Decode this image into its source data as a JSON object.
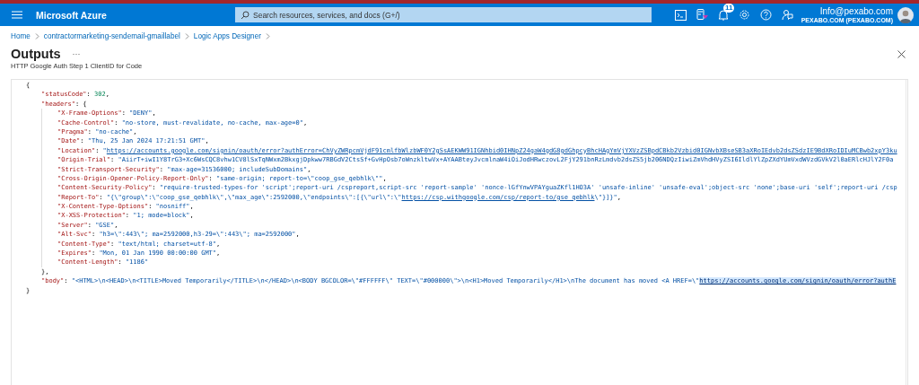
{
  "topbar": {
    "brand": "Microsoft Azure",
    "search": {
      "placeholder": "Search resources, services, and docs (G+/)"
    },
    "notification_count": "11",
    "account": {
      "email": "Info@pexabo.com",
      "directory": "PEXABO.COM (PEXABO.COM)"
    }
  },
  "breadcrumb": [
    "Home",
    "contractormarketing-sendemail-gmaillabel",
    "Logic Apps Designer"
  ],
  "panel": {
    "title": "Outputs",
    "more": "···",
    "subtitle": "HTTP Google Auth Step 1 ClientID for Code"
  },
  "code": [
    {
      "tokens": [
        {
          "kind": "punct",
          "text": "{"
        }
      ],
      "close": [
        {
          "kind": "punct",
          "text": "}"
        }
      ],
      "children": [
        {
          "tokens": [
            {
              "kind": "key",
              "text": "\"statusCode\""
            },
            {
              "kind": "punct",
              "text": ": "
            },
            {
              "kind": "num",
              "text": "302"
            },
            {
              "kind": "punct",
              "text": ","
            }
          ]
        },
        {
          "tokens": [
            {
              "kind": "key",
              "text": "\"headers\""
            },
            {
              "kind": "punct",
              "text": ": {"
            }
          ],
          "close": [
            {
              "kind": "punct",
              "text": "},"
            }
          ],
          "children": [
            {
              "tokens": [
                {
                  "kind": "key",
                  "text": "\"X-Frame-Options\""
                },
                {
                  "kind": "punct",
                  "text": ": "
                },
                {
                  "kind": "str",
                  "text": "\"DENY\""
                },
                {
                  "kind": "punct",
                  "text": ","
                }
              ]
            },
            {
              "tokens": [
                {
                  "kind": "key",
                  "text": "\"Cache-Control\""
                },
                {
                  "kind": "punct",
                  "text": ": "
                },
                {
                  "kind": "str",
                  "text": "\"no-store, must-revalidate, no-cache, max-age=0\""
                },
                {
                  "kind": "punct",
                  "text": ","
                }
              ]
            },
            {
              "tokens": [
                {
                  "kind": "key",
                  "text": "\"Pragma\""
                },
                {
                  "kind": "punct",
                  "text": ": "
                },
                {
                  "kind": "str",
                  "text": "\"no-cache\""
                },
                {
                  "kind": "punct",
                  "text": ","
                }
              ]
            },
            {
              "tokens": [
                {
                  "kind": "key",
                  "text": "\"Date\""
                },
                {
                  "kind": "punct",
                  "text": ": "
                },
                {
                  "kind": "str",
                  "text": "\"Thu, 25 Jan 2024 17:21:51 GMT\""
                },
                {
                  "kind": "punct",
                  "text": ","
                }
              ]
            },
            {
              "tokens": [
                {
                  "kind": "key",
                  "text": "\"Location\""
                },
                {
                  "kind": "punct",
                  "text": ": "
                },
                {
                  "kind": "str",
                  "text": "\""
                },
                {
                  "kind": "link",
                  "text": "https://accounts.google.com/signin/oauth/error?authError=ChVyZWRpcmVjdF91cmlfbWlzbWF0Y2gSsAEKWW91IGNhbid0IHNpZ24gaW4gdG8gdGhpcyBhcHAgYmVjYXVzZSBpdCBkb2Vzbid0IGNvbXBseSB3aXRoIEdvb2dsZSdzIE9BdXRoIDIuMCBwb2xpY3ku"
                }
              ]
            },
            {
              "tokens": [
                {
                  "kind": "key",
                  "text": "\"Origin-Trial\""
                },
                {
                  "kind": "punct",
                  "text": ": "
                },
                {
                  "kind": "str",
                  "text": "\"AiirT+iwI1Y8TrG3+Xc6WsCQC8vhw1CV8lSxTqNWxm2BkxgjDpkww7RBGdV2CtsSf+GvHpOsb7oWnzkltwVx+AYAABteyJvcmlnaW4iOiJodHRwczovL2FjY291bnRzLmdvb2dsZS5jb206NDQzIiwiZmVhdHVyZSI6IldlYlZpZXdYUmVxdWVzdGVkV2l0aERlcHJlY2F0a"
                }
              ]
            },
            {
              "tokens": [
                {
                  "kind": "key",
                  "text": "\"Strict-Transport-Security\""
                },
                {
                  "kind": "punct",
                  "text": ": "
                },
                {
                  "kind": "str",
                  "text": "\"max-age=31536000; includeSubDomains\""
                },
                {
                  "kind": "punct",
                  "text": ","
                }
              ]
            },
            {
              "tokens": [
                {
                  "kind": "key",
                  "text": "\"Cross-Origin-Opener-Policy-Report-Only\""
                },
                {
                  "kind": "punct",
                  "text": ": "
                },
                {
                  "kind": "str",
                  "text": "\"same-origin; report-to=\\\"coop_gse_qebhlk\\\"\""
                },
                {
                  "kind": "punct",
                  "text": ","
                }
              ]
            },
            {
              "tokens": [
                {
                  "kind": "key",
                  "text": "\"Content-Security-Policy\""
                },
                {
                  "kind": "punct",
                  "text": ": "
                },
                {
                  "kind": "str",
                  "text": "\"require-trusted-types-for 'script';report-uri /cspreport,script-src 'report-sample' 'nonce-lGfYnwVPAYguaZKfl1HO3A' 'unsafe-inline' 'unsafe-eval';object-src 'none';base-uri 'self';report-uri /csp"
                }
              ]
            },
            {
              "tokens": [
                {
                  "kind": "key",
                  "text": "\"Report-To\""
                },
                {
                  "kind": "punct",
                  "text": ": "
                },
                {
                  "kind": "str",
                  "text": "\"{\\\"group\\\":\\\"coop_gse_qebhlk\\\",\\\"max_age\\\":2592000,\\\"endpoints\\\":[{\\\"url\\\":\\\""
                },
                {
                  "kind": "link",
                  "text": "https://csp.withgoogle.com/csp/report-to/gse_qebhlk"
                },
                {
                  "kind": "str",
                  "text": "\\\"}]}\""
                },
                {
                  "kind": "punct",
                  "text": ","
                }
              ]
            },
            {
              "tokens": [
                {
                  "kind": "key",
                  "text": "\"X-Content-Type-Options\""
                },
                {
                  "kind": "punct",
                  "text": ": "
                },
                {
                  "kind": "str",
                  "text": "\"nosniff\""
                },
                {
                  "kind": "punct",
                  "text": ","
                }
              ]
            },
            {
              "tokens": [
                {
                  "kind": "key",
                  "text": "\"X-XSS-Protection\""
                },
                {
                  "kind": "punct",
                  "text": ": "
                },
                {
                  "kind": "str",
                  "text": "\"1; mode=block\""
                },
                {
                  "kind": "punct",
                  "text": ","
                }
              ]
            },
            {
              "tokens": [
                {
                  "kind": "key",
                  "text": "\"Server\""
                },
                {
                  "kind": "punct",
                  "text": ": "
                },
                {
                  "kind": "str",
                  "text": "\"GSE\""
                },
                {
                  "kind": "punct",
                  "text": ","
                }
              ]
            },
            {
              "tokens": [
                {
                  "kind": "key",
                  "text": "\"Alt-Svc\""
                },
                {
                  "kind": "punct",
                  "text": ": "
                },
                {
                  "kind": "str",
                  "text": "\"h3=\\\":443\\\"; ma=2592000,h3-29=\\\":443\\\"; ma=2592000\""
                },
                {
                  "kind": "punct",
                  "text": ","
                }
              ]
            },
            {
              "tokens": [
                {
                  "kind": "key",
                  "text": "\"Content-Type\""
                },
                {
                  "kind": "punct",
                  "text": ": "
                },
                {
                  "kind": "str",
                  "text": "\"text/html; charset=utf-8\""
                },
                {
                  "kind": "punct",
                  "text": ","
                }
              ]
            },
            {
              "tokens": [
                {
                  "kind": "key",
                  "text": "\"Expires\""
                },
                {
                  "kind": "punct",
                  "text": ": "
                },
                {
                  "kind": "str",
                  "text": "\"Mon, 01 Jan 1990 00:00:00 GMT\""
                },
                {
                  "kind": "punct",
                  "text": ","
                }
              ]
            },
            {
              "tokens": [
                {
                  "kind": "key",
                  "text": "\"Content-Length\""
                },
                {
                  "kind": "punct",
                  "text": ": "
                },
                {
                  "kind": "str",
                  "text": "\"1186\""
                }
              ]
            }
          ]
        },
        {
          "tokens": [
            {
              "kind": "key",
              "text": "\"body\""
            },
            {
              "kind": "punct",
              "text": ": "
            },
            {
              "kind": "str",
              "text": "\"<HTML>\\n<HEAD>\\n<TITLE>Moved Temporarily</TITLE>\\n</HEAD>\\n<BODY BGCOLOR=\\\"#FFFFFF\\\" TEXT=\\\"#000000\\\">\\n<H1>Moved Temporarily</H1>\\nThe document has moved <A HREF=\\\""
            },
            {
              "kind": "selected",
              "text": "https://accounts.google.com/signin/oauth/error?authE"
            }
          ]
        }
      ]
    }
  ]
}
